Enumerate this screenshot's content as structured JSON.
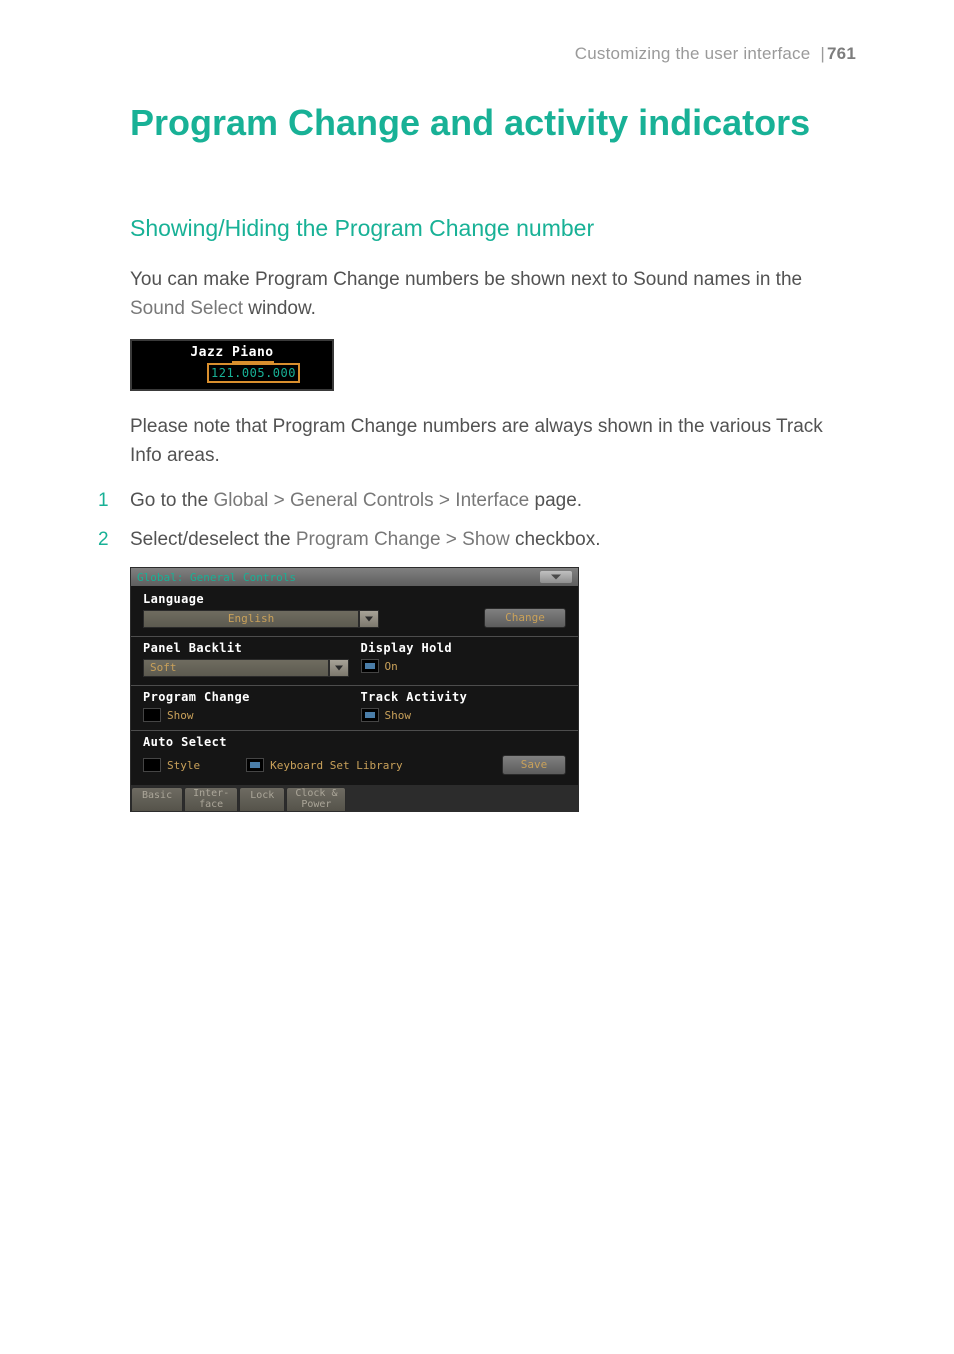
{
  "header": {
    "section": "Customizing the user interface",
    "page_number": "761"
  },
  "title": "Program Change and activity indicators",
  "section1": {
    "heading": "Showing/Hiding the Program Change number",
    "para1_a": "You can make Program Change numbers be shown next to Sound names in the ",
    "para1_ui": "Sound Select",
    "para1_b": " window.",
    "fig1": {
      "sound_name_a": "Jazz ",
      "sound_name_b": "Piano",
      "pc_number": "121.005.000"
    },
    "para2": "Please note that Program Change numbers are always shown in the various Track Info areas.",
    "steps": [
      {
        "a": "Go to the ",
        "ui": "Global > General Controls > Interface",
        "b": " page."
      },
      {
        "a": "Select/deselect the ",
        "ui": "Program Change > Show",
        "b": " checkbox."
      }
    ]
  },
  "fig2": {
    "title": "Global: General Controls",
    "language": {
      "label": "Language",
      "value": "English",
      "button": "Change"
    },
    "backlit": {
      "label": "Panel Backlit",
      "value": "Soft"
    },
    "display_hold": {
      "label": "Display Hold",
      "chk": "On"
    },
    "program_change": {
      "label": "Program Change",
      "chk": "Show"
    },
    "track_activity": {
      "label": "Track Activity",
      "chk": "Show"
    },
    "auto_select": {
      "label": "Auto Select",
      "style": "Style",
      "kbd": "Keyboard Set Library",
      "save": "Save"
    },
    "tabs": {
      "basic": "Basic",
      "interface_l1": "Inter-",
      "interface_l2": "face",
      "lock": "Lock",
      "clock_l1": "Clock &",
      "clock_l2": "Power"
    }
  }
}
